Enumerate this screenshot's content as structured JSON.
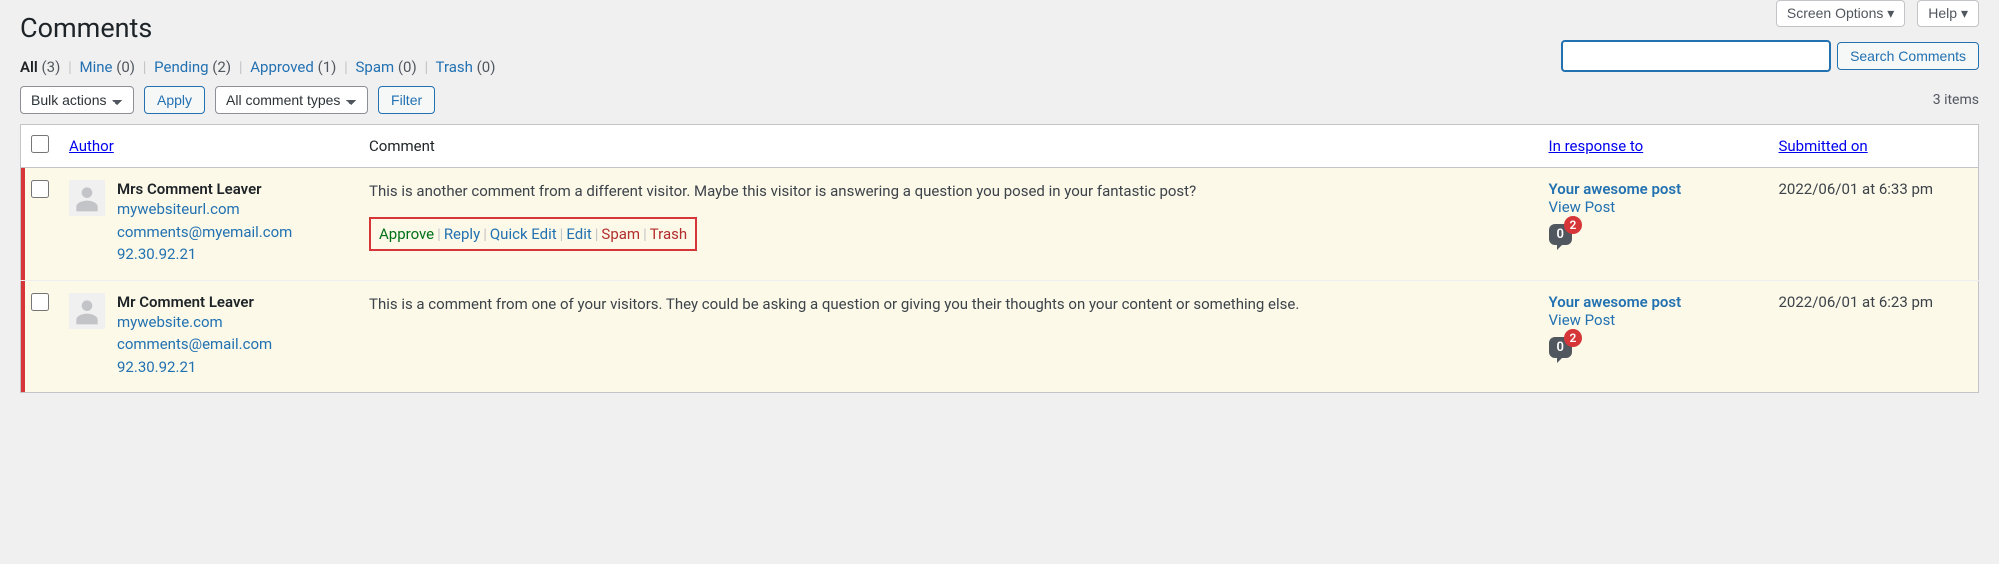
{
  "page_title": "Comments",
  "screen_meta": {
    "screen_options": "Screen Options ▾",
    "help": "Help ▾"
  },
  "filters": {
    "all": {
      "label": "All",
      "count": "(3)"
    },
    "mine": {
      "label": "Mine",
      "count": "(0)"
    },
    "pending": {
      "label": "Pending",
      "count": "(2)"
    },
    "approved": {
      "label": "Approved",
      "count": "(1)"
    },
    "spam": {
      "label": "Spam",
      "count": "(0)"
    },
    "trash": {
      "label": "Trash",
      "count": "(0)"
    }
  },
  "search": {
    "button": "Search Comments"
  },
  "bulk": {
    "actions_label": "Bulk actions",
    "apply": "Apply",
    "type_label": "All comment types",
    "filter": "Filter"
  },
  "items_count": "3 items",
  "columns": {
    "author": "Author",
    "comment": "Comment",
    "response": "In response to",
    "submitted": "Submitted on"
  },
  "row_actions": {
    "approve": "Approve",
    "reply": "Reply",
    "quick_edit": "Quick Edit",
    "edit": "Edit",
    "spam": "Spam",
    "trash": "Trash"
  },
  "comments": [
    {
      "author_name": "Mrs Comment Leaver",
      "author_url": "mywebsiteurl.com",
      "author_email": "comments@myemail.com",
      "author_ip": "92.30.92.21",
      "text": "This is another comment from a different visitor. Maybe this visitor is answering a question you posed in your fantastic post?",
      "post_title": "Your awesome post",
      "view_post": "View Post",
      "bubble_count": "0",
      "bubble_badge": "2",
      "submitted": "2022/06/01 at 6:33 pm",
      "show_actions": true
    },
    {
      "author_name": "Mr Comment Leaver",
      "author_url": "mywebsite.com",
      "author_email": "comments@email.com",
      "author_ip": "92.30.92.21",
      "text": "This is a comment from one of your visitors. They could be asking a question or giving you their thoughts on your content or something else.",
      "post_title": "Your awesome post",
      "view_post": "View Post",
      "bubble_count": "0",
      "bubble_badge": "2",
      "submitted": "2022/06/01 at 6:23 pm",
      "show_actions": false
    }
  ]
}
